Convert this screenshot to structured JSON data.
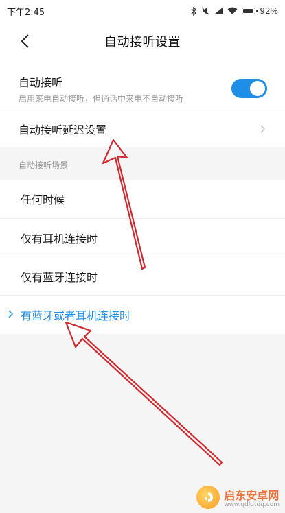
{
  "status_bar": {
    "time": "下午2:45",
    "battery_text": "92%",
    "battery_level": 0.92,
    "icons": [
      "bluetooth-icon",
      "mute-icon",
      "signal-icon",
      "wifi-icon",
      "battery-icon"
    ]
  },
  "header": {
    "back_icon": "chevron-left-icon",
    "title": "自动接听设置"
  },
  "settings": {
    "auto_answer": {
      "title": "自动接听",
      "subtitle": "启用来电自动接听，但通话中来电不自动接听",
      "enabled": true
    },
    "delay": {
      "title": "自动接听延迟设置",
      "chevron_icon": "chevron-right-icon"
    }
  },
  "scenario_section": {
    "header": "自动接听场景",
    "options": [
      {
        "label": "任何时候",
        "selected": false
      },
      {
        "label": "仅有耳机连接时",
        "selected": false
      },
      {
        "label": "仅有蓝牙连接时",
        "selected": false
      },
      {
        "label": "有蓝牙或者耳机连接时",
        "selected": true
      }
    ]
  },
  "watermark": {
    "brand": "启东安卓网",
    "url": "www.qdldtdq.com"
  },
  "colors": {
    "accent": "#1f8ee6",
    "arrow": "#d0282e",
    "background": "#f5f5f5"
  }
}
